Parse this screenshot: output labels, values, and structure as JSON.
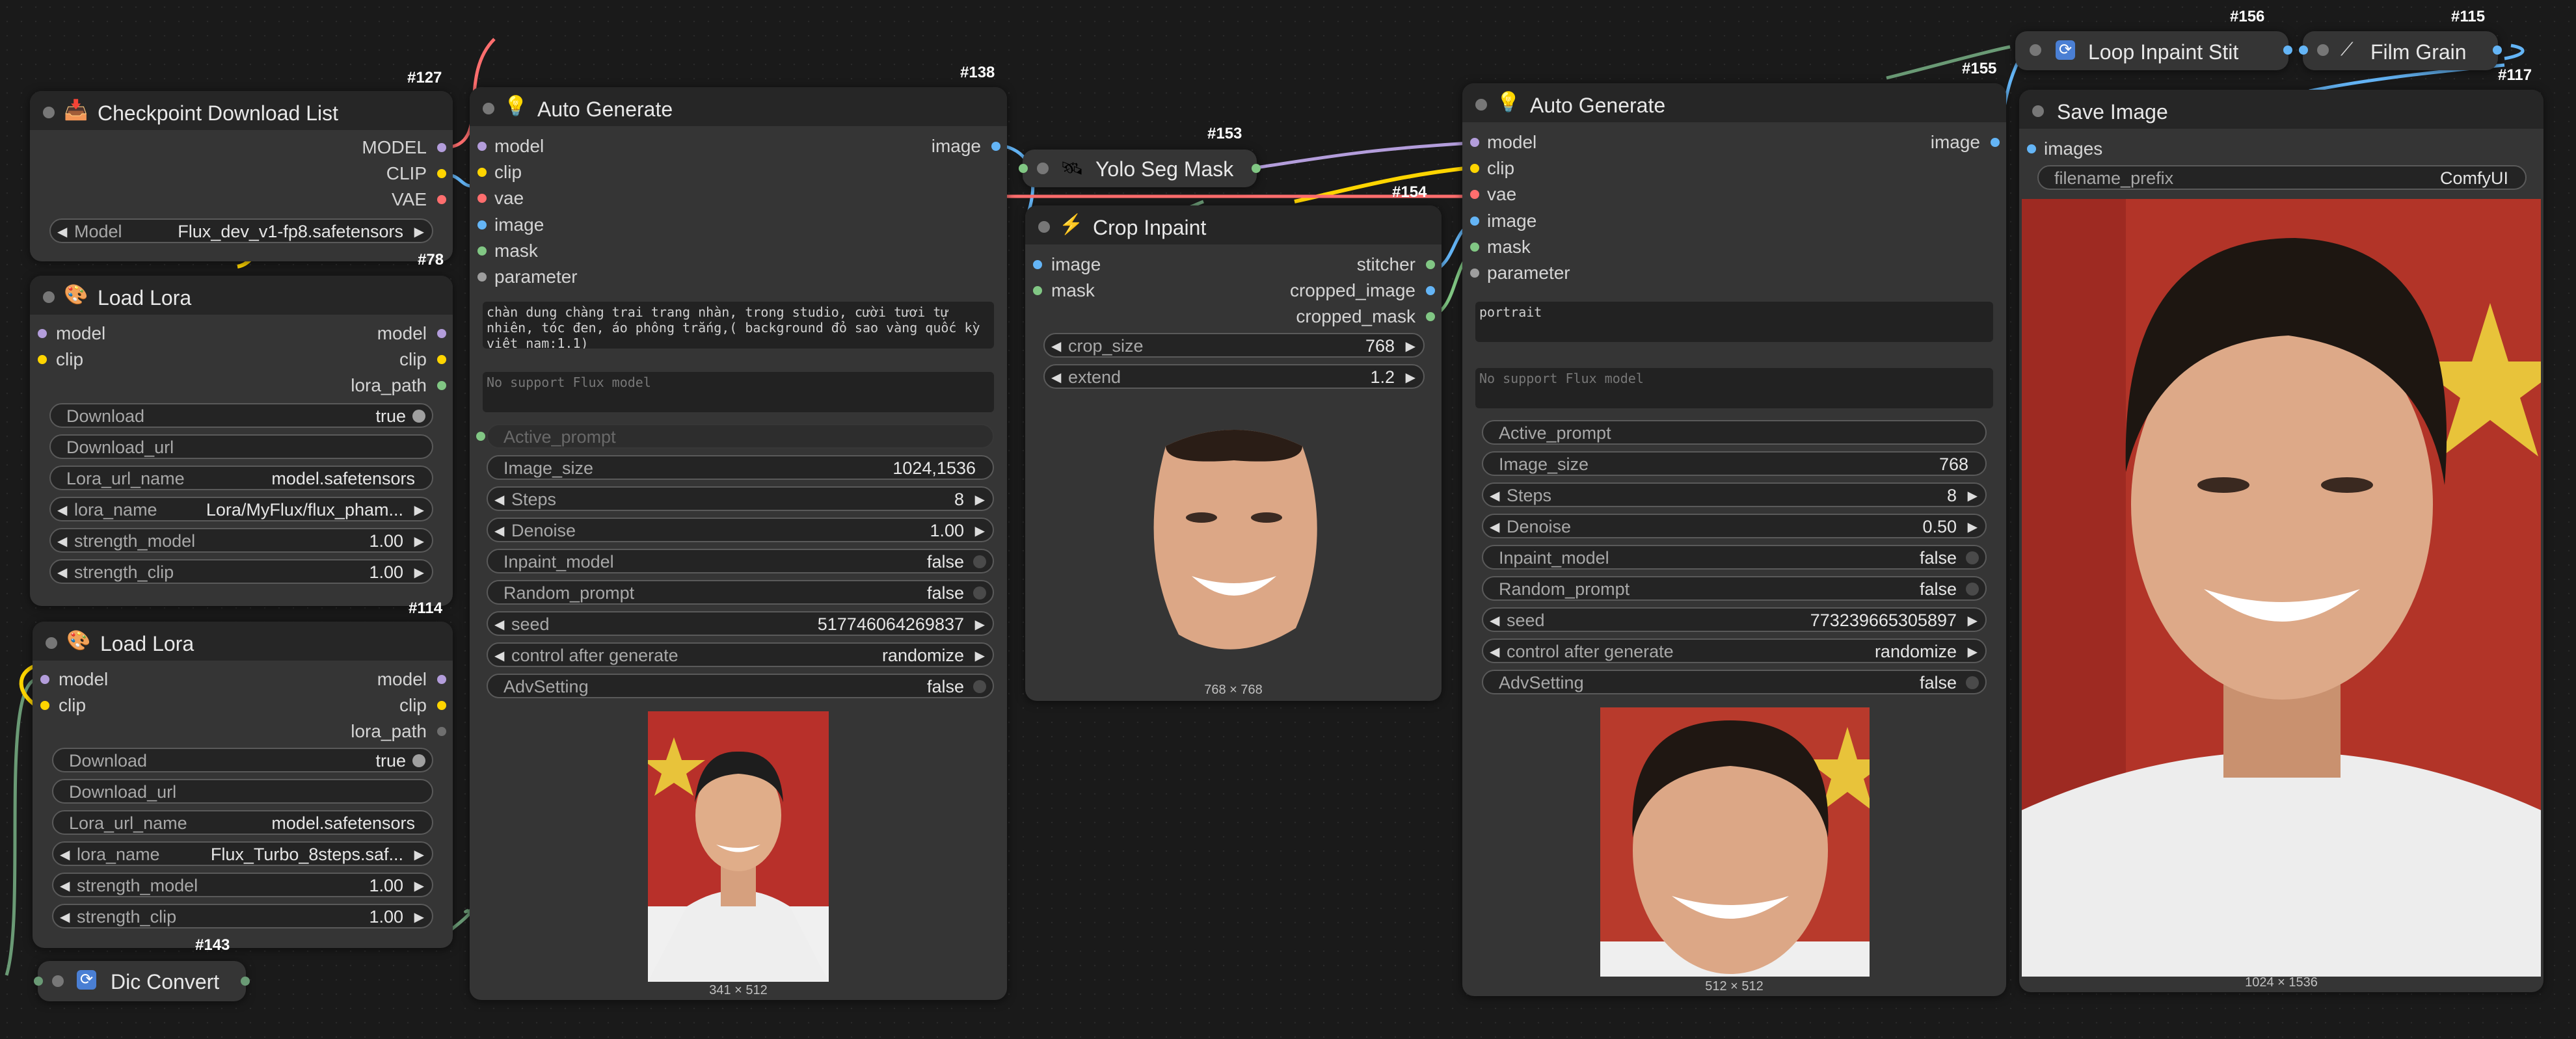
{
  "colors": {
    "canvas": "#1a1a1a",
    "node_bg": "#353535",
    "node_header": "#262626",
    "model": "#b39ddb",
    "clip": "#ffd500",
    "vae": "#ff6e6e",
    "image": "#64b5f6",
    "mask": "#81c784",
    "parameter": "#9e9e9e",
    "lora_path": "#81c784",
    "links_teal": "#6a9a75"
  },
  "nodes": {
    "checkpoint": {
      "id": "#127",
      "icon": "download-box-icon",
      "title": "Checkpoint Download List",
      "outputs": [
        "MODEL",
        "CLIP",
        "VAE"
      ],
      "model": {
        "label": "Model",
        "value": "Flux_dev_v1-fp8.safetensors"
      }
    },
    "lora1": {
      "id": "#78",
      "icon": "palette-icon",
      "title": "Load Lora",
      "inputs": [
        "model",
        "clip"
      ],
      "outputs": [
        "model",
        "clip",
        "lora_path"
      ],
      "widgets": {
        "download": {
          "label": "Download",
          "value": "true"
        },
        "download_url": {
          "label": "Download_url"
        },
        "lora_url_name": {
          "label": "Lora_url_name",
          "value": "model.safetensors"
        },
        "lora_name": {
          "label": "lora_name",
          "value": "Lora/MyFlux/flux_pham..."
        },
        "strength_model": {
          "label": "strength_model",
          "value": "1.00"
        },
        "strength_clip": {
          "label": "strength_clip",
          "value": "1.00"
        }
      }
    },
    "lora2": {
      "id": "#114",
      "icon": "palette-icon",
      "title": "Load Lora",
      "inputs": [
        "model",
        "clip"
      ],
      "outputs": [
        "model",
        "clip",
        "lora_path"
      ],
      "widgets": {
        "download": {
          "label": "Download",
          "value": "true"
        },
        "download_url": {
          "label": "Download_url"
        },
        "lora_url_name": {
          "label": "Lora_url_name",
          "value": "model.safetensors"
        },
        "lora_name": {
          "label": "lora_name",
          "value": "Flux_Turbo_8steps.saf..."
        },
        "strength_model": {
          "label": "strength_model",
          "value": "1.00"
        },
        "strength_clip": {
          "label": "strength_clip",
          "value": "1.00"
        }
      }
    },
    "dic": {
      "id": "#143",
      "icon": "loop-icon",
      "title": "Dic Convert"
    },
    "auto1": {
      "id": "#138",
      "icon": "lightbulb-icon",
      "title": "Auto Generate",
      "inputs": [
        "model",
        "clip",
        "vae",
        "image",
        "mask",
        "parameter"
      ],
      "output": "image",
      "prompt": "chàn dung chàng trai trang nhàn, trong studio, cười tươi tự nhiên, tóc đen, áo phông trắng,( background đỏ sao vàng quốc kỳ việt nam:1.1)",
      "prompt2": "No support Flux model",
      "widgets": {
        "active_prompt": {
          "label": "Active_prompt"
        },
        "image_size": {
          "label": "Image_size",
          "value": "1024,1536"
        },
        "steps": {
          "label": "Steps",
          "value": "8"
        },
        "denoise": {
          "label": "Denoise",
          "value": "1.00"
        },
        "inpaint_model": {
          "label": "Inpaint_model",
          "value": "false"
        },
        "random_prompt": {
          "label": "Random_prompt",
          "value": "false"
        },
        "seed": {
          "label": "seed",
          "value": "517746064269837"
        },
        "control": {
          "label": "control after generate",
          "value": "randomize"
        },
        "advsetting": {
          "label": "AdvSetting",
          "value": "false"
        }
      },
      "caption": "341 × 512"
    },
    "yolo": {
      "id": "#153",
      "icon": "yolo-icon",
      "title": "Yolo Seg Mask"
    },
    "crop": {
      "id": "#154",
      "icon": "lightning-icon",
      "title": "Crop Inpaint",
      "inputs": [
        "image",
        "mask"
      ],
      "outputs": [
        "stitcher",
        "cropped_image",
        "cropped_mask"
      ],
      "widgets": {
        "crop_size": {
          "label": "crop_size",
          "value": "768"
        },
        "extend": {
          "label": "extend",
          "value": "1.2"
        }
      },
      "caption": "768 × 768"
    },
    "auto2": {
      "id": "#155",
      "icon": "lightbulb-icon",
      "title": "Auto Generate",
      "inputs": [
        "model",
        "clip",
        "vae",
        "image",
        "mask",
        "parameter"
      ],
      "output": "image",
      "prompt": "portrait",
      "prompt2": "No support Flux model",
      "widgets": {
        "active_prompt": {
          "label": "Active_prompt"
        },
        "image_size": {
          "label": "Image_size",
          "value": "768"
        },
        "steps": {
          "label": "Steps",
          "value": "8"
        },
        "denoise": {
          "label": "Denoise",
          "value": "0.50"
        },
        "inpaint_model": {
          "label": "Inpaint_model",
          "value": "false"
        },
        "random_prompt": {
          "label": "Random_prompt",
          "value": "false"
        },
        "seed": {
          "label": "seed",
          "value": "773239665305897"
        },
        "control": {
          "label": "control after generate",
          "value": "randomize"
        },
        "advsetting": {
          "label": "AdvSetting",
          "value": "false"
        }
      },
      "caption": "512 × 512"
    },
    "loop": {
      "id": "#156",
      "icon": "loop-icon",
      "title": "Loop Inpaint Stit"
    },
    "film": {
      "id": "#115",
      "icon": "wand-icon",
      "title": "Film Grain"
    },
    "save": {
      "id": "#117",
      "title": "Save Image",
      "input": "images",
      "filename": {
        "label": "filename_prefix",
        "value": "ComfyUI"
      },
      "caption": "1024 × 1536"
    }
  }
}
